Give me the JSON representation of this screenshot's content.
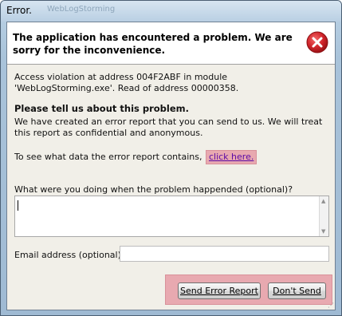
{
  "window": {
    "title": "Error.",
    "ghost_title": "WebLogStorming"
  },
  "header": {
    "message": "The application has encountered a problem. We are sorry for the inconvenience.",
    "icon": "error-icon",
    "icon_color": "#d0242a"
  },
  "details": {
    "violation": "Access violation at address 004F2ABF in module 'WebLogStorming.exe'. Read of address 00000358."
  },
  "request": {
    "title": "Please tell us about this problem.",
    "description": "We have created an error report that you can send to us. We will treat this report as confidential and anonymous.",
    "see_data_text": "To see what data the error report contains,",
    "link_label": "click here."
  },
  "form": {
    "question_label": "What were you doing when the problem happended (optional)?",
    "question_value": "",
    "email_label": "Email address (optional):",
    "email_value": ""
  },
  "buttons": {
    "send_label": "Send Error Report",
    "dont_send_label": "Don't Send"
  },
  "colors": {
    "highlight": "#e8a9b0",
    "link": "#5b0aa5"
  }
}
